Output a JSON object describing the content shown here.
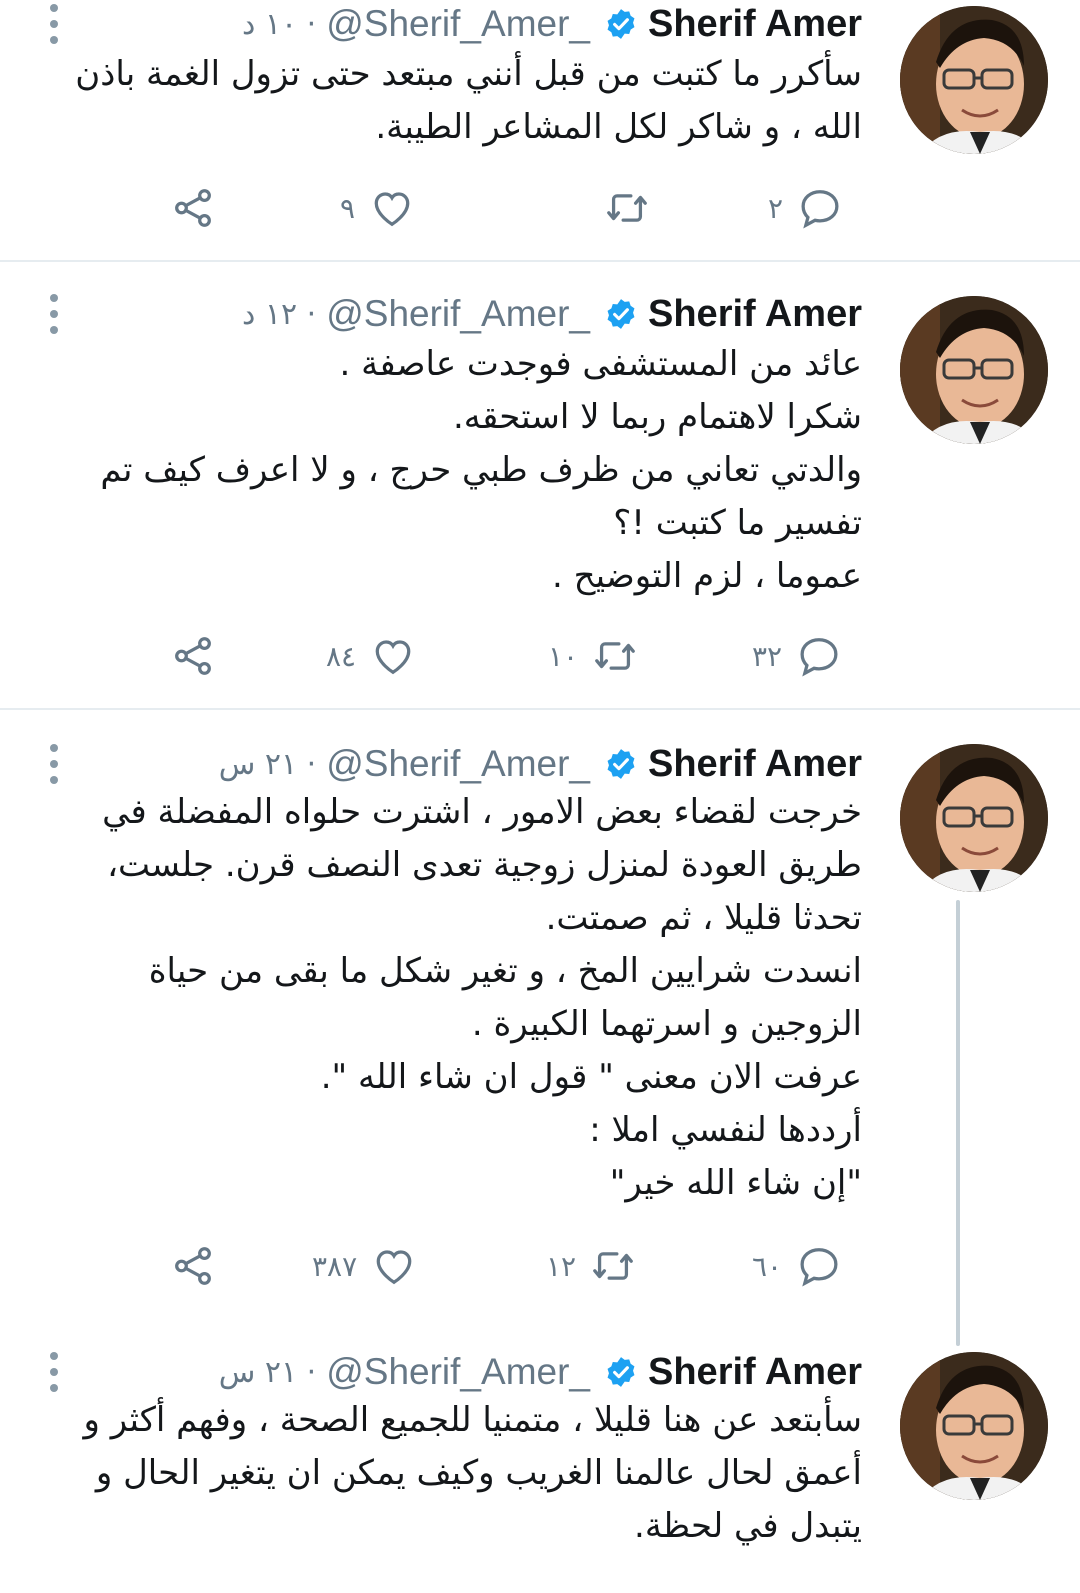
{
  "tweets": [
    {
      "name": "Sherif Amer",
      "handle": "@Sherif_Amer_",
      "time": "· ١٠ د",
      "lines": [
        "سأكرر ما كتبت من قبل أنني مبتعد حتى تزول الغمة باذن",
        "الله ، و شاكر لكل المشاعر الطيبة."
      ],
      "replies": "٢",
      "retweets": "",
      "likes": "٩"
    },
    {
      "name": "Sherif Amer",
      "handle": "@Sherif_Amer_",
      "time": "· ١٢ د",
      "lines": [
        "عائد من المستشفى فوجدت عاصفة .",
        "شكرا لاهتمام ربما لا استحقه.",
        "والدتي تعاني من ظرف طبي حرج ، و لا اعرف كيف تم",
        "تفسير ما كتبت !؟",
        "عموما ، لزم التوضيح ."
      ],
      "replies": "٣٢",
      "retweets": "١٠",
      "likes": "٨٤"
    },
    {
      "name": "Sherif Amer",
      "handle": "@Sherif_Amer_",
      "time": "· ٢١ س",
      "lines": [
        "خرجت لقضاء بعض الامور ، اشترت حلواه المفضلة في",
        "طريق العودة لمنزل زوجية تعدى النصف قرن. جلست،",
        "تحدثا قليلا ، ثم صمتت.",
        "انسدت شرايين المخ ، و تغير شكل ما بقى من حياة",
        "الزوجين و اسرتهما الكبيرة .",
        "عرفت الان معنى \" قول ان شاء الله \".",
        "أرددها لنفسي املا :",
        "\"إن شاء الله خير\""
      ],
      "replies": "٦٠",
      "retweets": "١٢",
      "likes": "٣٨٧"
    },
    {
      "name": "Sherif Amer",
      "handle": "@Sherif_Amer_",
      "time": "· ٢١ س",
      "lines": [
        "سأبتعد عن هنا قليلا ، متمنيا للجميع الصحة ، وفهم أكثر و",
        "أعمق لحال عالمنا الغريب وكيف يمكن ان يتغير الحال و",
        "يتبدل في لحظة."
      ],
      "replies": "",
      "retweets": "",
      "likes": ""
    }
  ],
  "icons": {
    "reply": "reply-icon",
    "retweet": "retweet-icon",
    "like": "heart-icon",
    "share": "share-icon",
    "verified": "verified-badge-icon",
    "more": "more-options-icon"
  },
  "colors": {
    "name": "#14171a",
    "secondary": "#657786",
    "verified": "#1da1f2",
    "divider": "#e6ecf0",
    "thread_line": "#c4cfd6"
  }
}
